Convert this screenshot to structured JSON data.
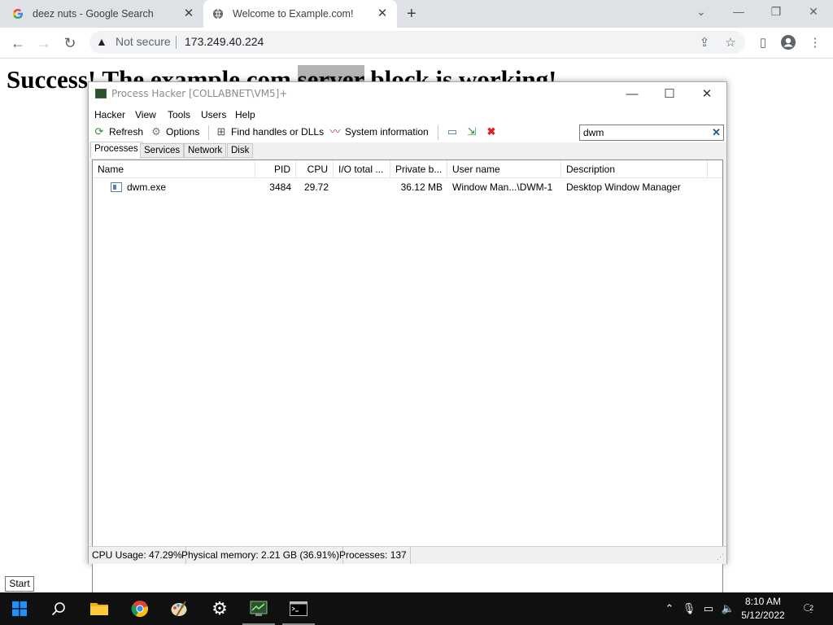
{
  "browser": {
    "tabs": [
      {
        "title": "deez nuts - Google Search",
        "active": false
      },
      {
        "title": "Welcome to Example.com!",
        "active": true
      }
    ],
    "security_label": "Not secure",
    "url": "173.249.40.224"
  },
  "page": {
    "heading_before": "Success! The example.com ",
    "heading_highlight": "server",
    "heading_after": " block is working!"
  },
  "process_hacker": {
    "title": "Process Hacker [COLLABNET\\VM5]+",
    "menu": [
      "Hacker",
      "View",
      "Tools",
      "Users",
      "Help"
    ],
    "toolbar": {
      "refresh": "Refresh",
      "options": "Options",
      "find_handles": "Find handles or DLLs",
      "system_info": "System information"
    },
    "search_value": "dwm",
    "tabs": [
      "Processes",
      "Services",
      "Network",
      "Disk"
    ],
    "active_tab": "Processes",
    "columns": [
      "Name",
      "PID",
      "CPU",
      "I/O total ...",
      "Private b...",
      "User name",
      "Description"
    ],
    "rows": [
      {
        "name": "dwm.exe",
        "pid": "3484",
        "cpu": "29.72",
        "io_total": "",
        "private_bytes": "36.12 MB",
        "user_name": "Window Man...\\DWM-1",
        "description": "Desktop Window Manager"
      }
    ],
    "status": {
      "cpu_usage": "CPU Usage: 47.29%",
      "physical_memory": "Physical memory: 2.21 GB (36.91%)",
      "processes": "Processes: 137"
    }
  },
  "tooltip": "Start",
  "taskbar": {
    "time": "8:10 AM",
    "date": "5/12/2022",
    "notification_count": "2"
  },
  "colors": {
    "tabstrip_bg": "#dee1e6",
    "taskbar_bg": "#101010",
    "highlight": "#b3b3b3",
    "close_red": "#e02020"
  }
}
